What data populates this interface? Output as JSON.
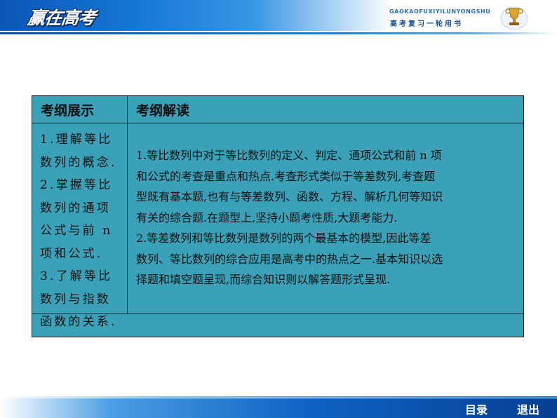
{
  "header": {
    "logo_text": "赢在高考",
    "brand_pinyin": "GAOKAOFUXIYILUNYONGSHU",
    "brand_subtitle": "高考复习一轮用书"
  },
  "table": {
    "col1_header": "考纲展示",
    "col2_header": "考纲解读",
    "left_lines": [
      "1.理解等比",
      "数列的概念.",
      "2.掌握等比",
      "数列的通项",
      "公式与前 n",
      "项和公式.",
      "3.了解等比",
      "数列与指数",
      "函数的关系."
    ],
    "right_p1_lines": [
      "1.等比数列中对于等比数列的定义、判定、通项公式和前 n 项",
      "和公式的考查是重点和热点.考查形式类似于等差数列,考查题",
      "型既有基本题,也有与等差数列、函数、方程、解析几何等知识",
      "有关的综合题.在题型上,坚持小题考性质,大题考能力."
    ],
    "right_p2_lines": [
      "2.等差数列和等比数列是数列的两个最基本的模型,因此等差",
      "数列、等比数列的综合应用是高考中的热点之一.基本知识以选",
      "择题和填空题呈现,而综合知识则以解答题形式呈现."
    ]
  },
  "footer": {
    "toc_label": "目录",
    "exit_label": "退出"
  },
  "colors": {
    "table_bg": "#3aa1b9",
    "header_blue": "#1677d6",
    "footer_blue": "#0f63c4"
  }
}
